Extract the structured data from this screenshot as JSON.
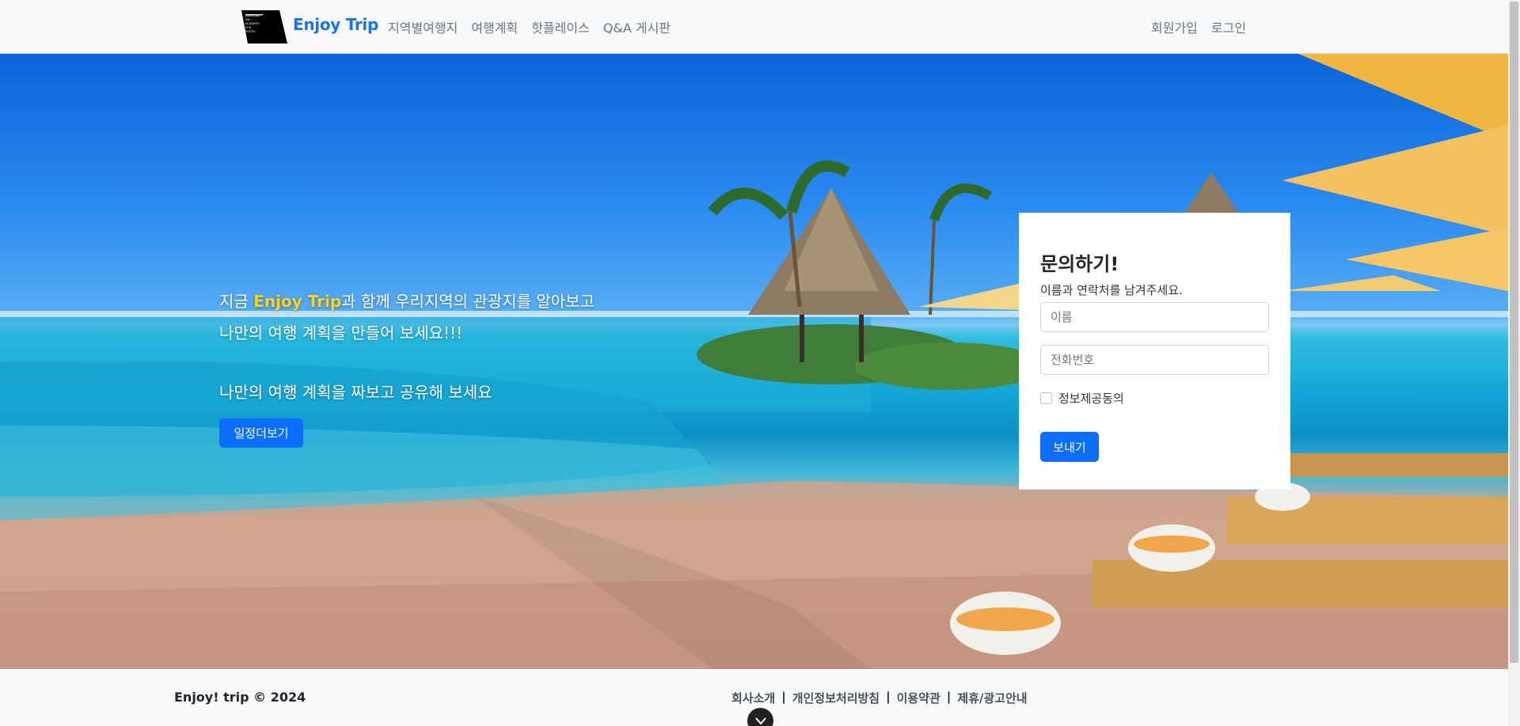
{
  "navbar": {
    "brand": "Enjoy Trip",
    "logo_text": "SAMSUNG SW ACADEMY FOR YOUTH",
    "links": [
      "지역별여행지",
      "여행계획",
      "핫플레이스",
      "Q&A 게시판"
    ],
    "right_links": [
      "회원가입",
      "로그인"
    ]
  },
  "hero": {
    "line1_prefix": "지금 ",
    "line1_highlight": "Enjoy Trip",
    "line1_suffix": "과 함께 우리지역의 관광지를 알아보고",
    "line2": "나만의 여행 계획을 만들어 보세요!!!",
    "line3": "나만의 여행 계획을 짜보고 공유해 보세요",
    "cta_label": "일정더보기"
  },
  "contact": {
    "title": "문의하기!",
    "subtitle": "이름과 연락처를 남겨주세요.",
    "name_placeholder": "이름",
    "phone_placeholder": "전화번호",
    "consent_label": "정보제공동의",
    "consent_checked": false,
    "submit_label": "보내기"
  },
  "footer": {
    "copyright": "Enjoy! trip © 2024",
    "links": [
      "회사소개",
      "개인정보처리방침",
      "이용약관",
      "제휴/광고안내"
    ],
    "separator": "|"
  },
  "colors": {
    "brand": "#1a73e8",
    "primary": "#0d6efd",
    "highlight": "#ffd21f"
  },
  "icons": {
    "scroll_top": "chevron-down-icon"
  }
}
